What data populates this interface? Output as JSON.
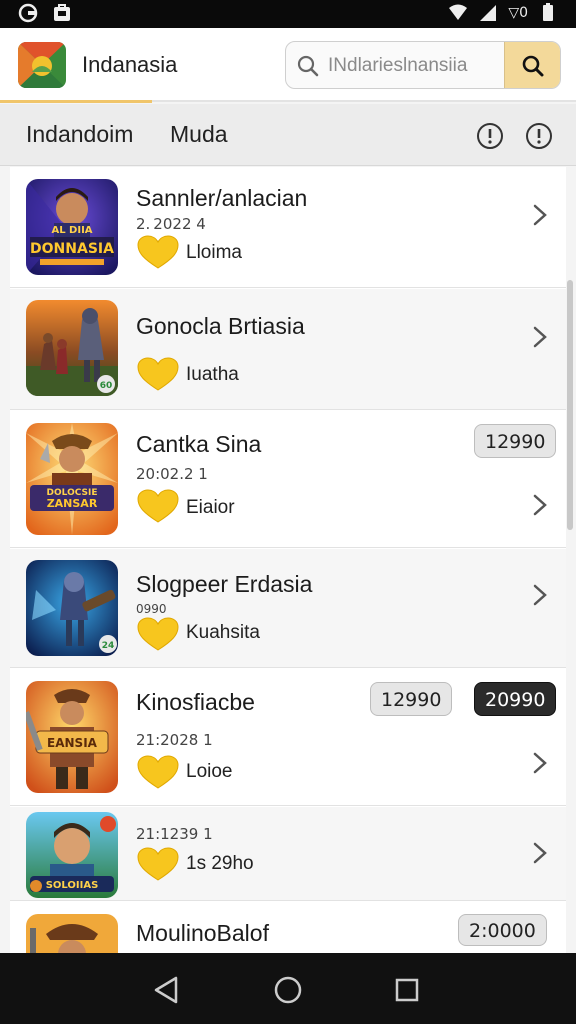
{
  "status_bar": {
    "carrier_text": "▽0",
    "icons": [
      "circle-app-icon",
      "shopping-bag-icon",
      "signal-icon",
      "battery-icon"
    ]
  },
  "app_bar": {
    "title": "Indanasia",
    "search_placeholder": "INdlarieslnansiia"
  },
  "tabs": [
    {
      "label": "Indandoim"
    },
    {
      "label": "Muda"
    }
  ],
  "list": {
    "items": [
      {
        "title": "Sannler/anlacian",
        "meta": "2. 2022 4",
        "sub": "Lloima",
        "thumb_banner": "DONNASIA",
        "thumb_top": "AL DIIA",
        "badges": []
      },
      {
        "title": "Gonocla Brtiasia",
        "meta": "",
        "sub": "Iuatha",
        "thumb_banner": "",
        "thumb_top": "",
        "badges": []
      },
      {
        "title": "Cantka Sina",
        "meta": "20:02.2 1",
        "sub": "Eiaior",
        "thumb_banner": "ZANSAR",
        "thumb_top": "DOLOCSIE",
        "badges": [
          "12990"
        ]
      },
      {
        "title": "Slogpeer Erdasia",
        "meta": "0990",
        "sub": "Kuahsita",
        "thumb_banner": "",
        "thumb_top": "",
        "badges": []
      },
      {
        "title": "Kinosfiacbe",
        "meta": "21:2028 1",
        "sub": "Loioe",
        "thumb_banner": "EANSIA",
        "thumb_top": "",
        "badges": [
          "12990",
          "20990"
        ]
      },
      {
        "title": "",
        "meta": "21:1239 1",
        "sub": "1s 29ho",
        "thumb_banner": "SOLOIIAS",
        "thumb_top": "",
        "badges": []
      },
      {
        "title": "MoulinoBalof",
        "meta": "",
        "sub": "",
        "thumb_banner": "",
        "thumb_top": "",
        "badges": [
          "2:0000"
        ]
      }
    ]
  },
  "colors": {
    "accent": "#f0c56a",
    "heart": "#f7c61e",
    "status_bar": "#0a0a0a",
    "nav_bar": "#111111"
  }
}
